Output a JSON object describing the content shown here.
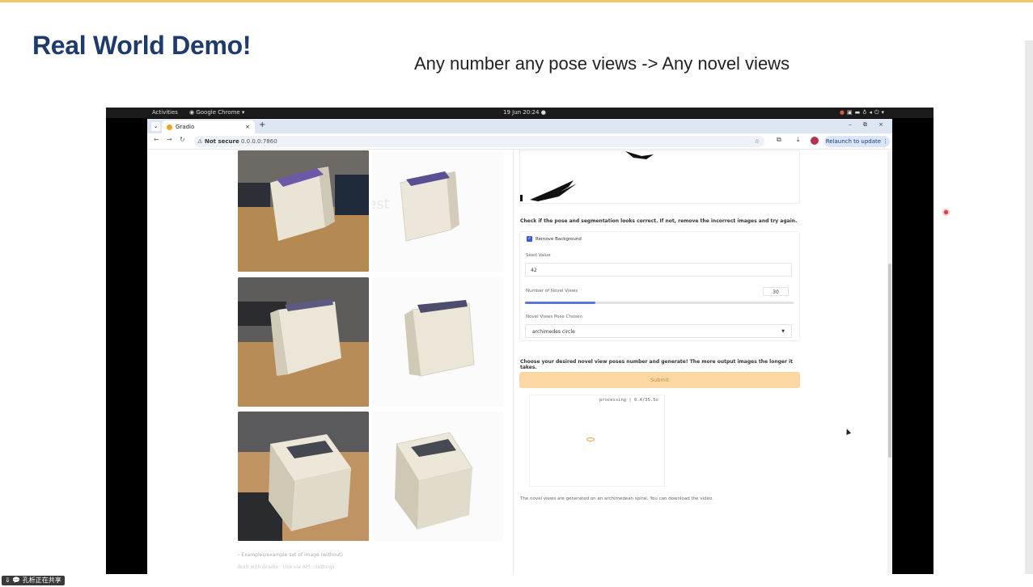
{
  "slide": {
    "title": "Real World Demo!",
    "subtitle": "Any number any pose views -> Any novel views",
    "share_badge": "⇓ 💬 孔析正在共享"
  },
  "system_bar": {
    "activities": "Activities",
    "app_menu": "◉ Google Chrome ▾",
    "clock": "19 Jun  20:24  ●",
    "tray_icons": [
      "camera-icon",
      "screen-icon",
      "network-icon",
      "volume-icon",
      "power-icon"
    ]
  },
  "browser": {
    "tab_title": "Gradio",
    "tab_close": "×",
    "new_tab": "+",
    "window_controls": "–  ⧉  ×",
    "security_label": "Not secure",
    "url": "0.0.0.0:7860",
    "relaunch_label": "Relaunch to update  ⋮"
  },
  "gradio": {
    "pose_check_note": "Check if the pose and segmentation looks correct. If not, remove the incorrect images and try again.",
    "remove_background_label": "Remove Background",
    "remove_background_checked": true,
    "seed_label": "Seed Value",
    "seed_value": "42",
    "novel_views_label": "Number of Novel Views",
    "novel_views_value": "30",
    "novel_views_fraction": 0.26,
    "pose_label": "Novel Views Pose Chosen",
    "pose_value": "archimedes circle",
    "generate_note": "Choose your desired novel view poses number and generate! The more output images the longer it takes.",
    "submit_label": "Submit",
    "processing_text": "processing | 0.4/35.5s",
    "output_note": "The novel views are generated on an archimedean spiral. You can download the video.",
    "left_footer": "› Examples/example set of image (without)",
    "left_footer2": "Built with Gradio  ·  Use via API  ·  Settings"
  },
  "colors": {
    "title_blue": "#1f3b6b",
    "accent_stripe": "#f2c96a",
    "submit_orange": "#fbd7a4",
    "checkbox_blue": "#3b5bdb"
  }
}
